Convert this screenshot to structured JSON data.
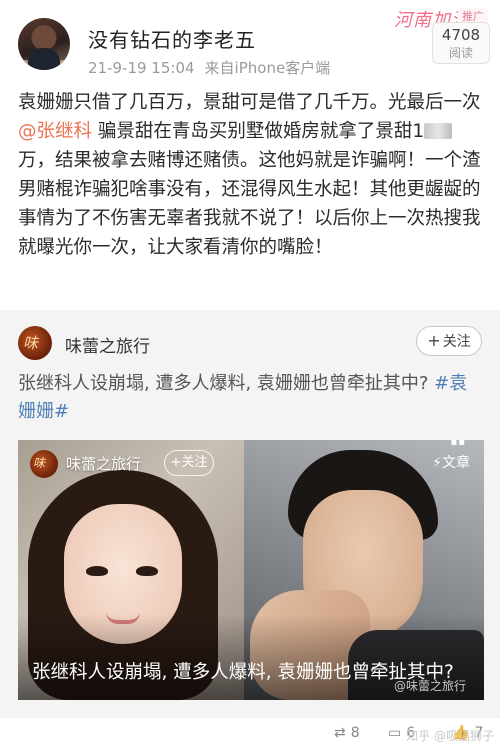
{
  "header": {
    "username": "没有钻石的李老五",
    "date": "21-9-19 15:04",
    "source": "来自iPhone客户端",
    "promo_text": "河南加油",
    "promo_tag": "推广",
    "read_count": "4708",
    "read_label": "阅读"
  },
  "post": {
    "part1": "袁姗姗只借了几百万，景甜可是借了几千万。光最后一次",
    "mention": "@张继科",
    "part2": " 骗景甜在青岛买别墅做婚房就拿了景甜1",
    "part3": "万，结果被拿去赌博还赌债。这他妈就是诈骗啊！一个渣男赌棍诈骗犯啥事没有，还混得风生水起！其他更龌龊的事情为了不伤害无辜者我就不说了！以后你上一次热搜我就曝光你一次，让大家看清你的嘴脸！"
  },
  "repost": {
    "avatar_glyph": "味",
    "name": "味蕾之旅行",
    "follow_label": "关注",
    "text": "张继科人设崩塌, 遭多人爆料, 袁姗姗也曾牵扯其中? ",
    "hashtag": "#袁姗姗#"
  },
  "article": {
    "avatar_glyph": "味",
    "author": "味蕾之旅行",
    "follow_label": "+关注",
    "type_label": "文章",
    "title": "张继科人设崩塌, 遭多人爆料, 袁姗姗也曾牵扯其中?",
    "watermark": "@味蕾之旅行"
  },
  "footer": {
    "repost_count": "8",
    "comment_count": "6",
    "like_count": "7",
    "watermark": "知乎 @吸猫狮子"
  },
  "colors": {
    "mention": "#eb7350",
    "hashtag": "#4e7fb5",
    "promo": "#ef6f8a"
  },
  "icons": {
    "repost": "repost-icon",
    "comment": "comment-icon",
    "like": "like-icon",
    "article_type": "lightning-icon"
  }
}
